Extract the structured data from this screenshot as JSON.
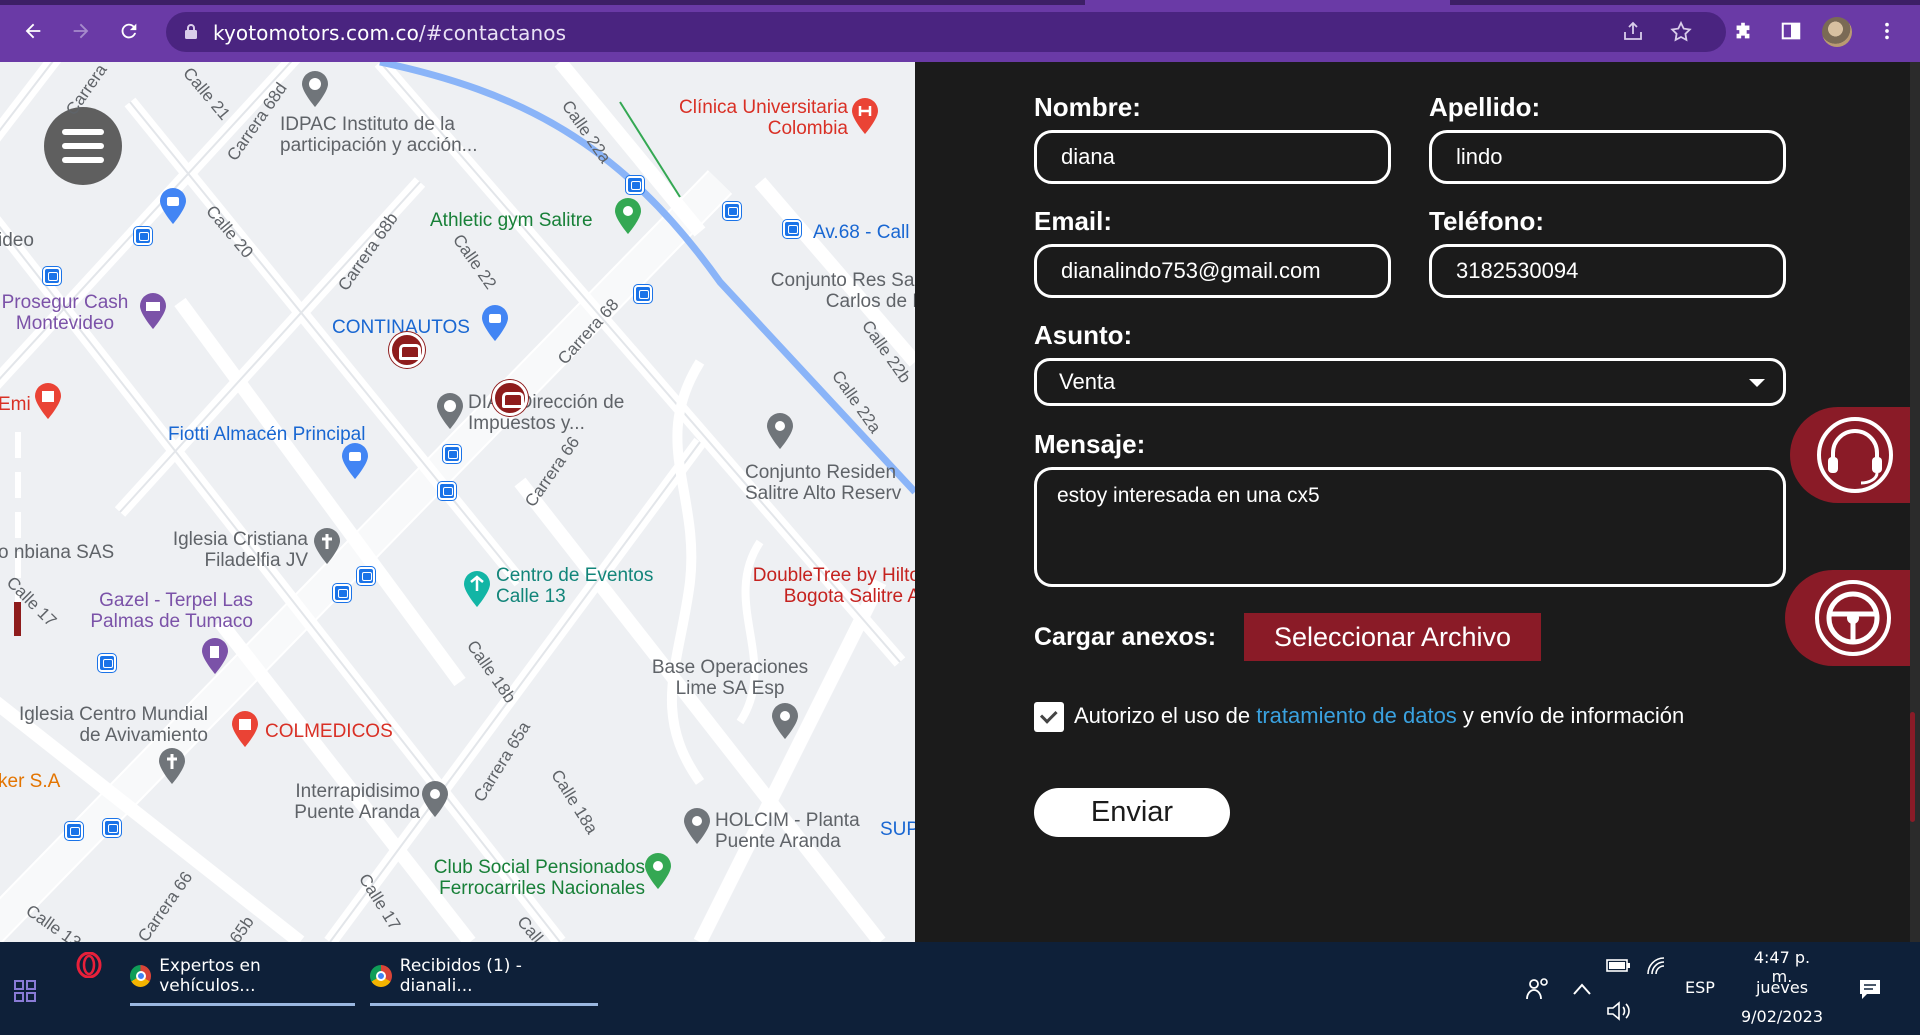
{
  "browser": {
    "url_host": "kyotomotors.com.co",
    "url_path": "/#contactanos",
    "icons": [
      "back-icon",
      "forward-icon",
      "reload-icon",
      "lock-icon",
      "share-icon",
      "star-icon",
      "extensions-icon",
      "sidepanel-icon",
      "avatar",
      "more-icon"
    ]
  },
  "map": {
    "places": {
      "idpac": "IDPAC Instituto de la participación y acción...",
      "clinica": "Clínica Universitaria Colombia",
      "athletic": "Athletic gym Salitre",
      "av68": "Av.68 - Call",
      "conjunto_res": "Conjunto Res San Carlos de B",
      "prosegur": "Prosegur Cash Montevideo",
      "continautos": "CONTINAUTOS",
      "dian": "DIAN Dirección de Impuestos y...",
      "emi": "Emi",
      "fiotti": "Fiotti Almacén Principal",
      "conjunto_salitre": "Conjunto Residen Salitre Alto Reserv",
      "iglesia_filadelfia": "Iglesia Cristiana Filadelfia JV",
      "nbiana": "o nbiana SAS",
      "centro_eventos": "Centro de Eventos Calle 13",
      "doubletree": "DoubleTree by Hilto Bogota Salitre A",
      "gazel": "Gazel - Terpel Las Palmas de Tumaco",
      "base_op": "Base Operaciones Lime SA Esp",
      "iglesia_centro": "Iglesia Centro Mundial de Avivamiento",
      "colmedicos": "COLMEDICOS",
      "ker": "ker S.A",
      "interrapidisimo": "Interrapidisimo Puente Aranda",
      "holcim": "HOLCIM - Planta Puente Aranda",
      "sup": "SUP",
      "club_social": "Club Social Pensionados Ferrocarriles Nacionales",
      "ideo": "ideo"
    },
    "streets": {
      "carrera_a": "Carrera",
      "calle21": "Calle 21",
      "carrera68d": "Carrera 68d",
      "calle22a": "Calle 22a",
      "calle20": "Calle 20",
      "carrera68b": "Carrera 68b",
      "calle22": "Calle 22",
      "carrera68": "Carrera 68",
      "calle22b": "Calle 22b",
      "calle22a_2": "Calle 22a",
      "carrera66": "Carrera 66",
      "calle17": "Calle 17",
      "calle18b": "Calle 18b",
      "carrera65a": "Carrera 65a",
      "calle18a": "Calle 18a",
      "carrera66_2": "Carrera 66",
      "calle17_2": "Calle 17",
      "calle13": "Calle 13",
      "k65b": "65b",
      "calle_c": "Call"
    }
  },
  "form": {
    "nombre_label": "Nombre:",
    "nombre_value": "diana",
    "apellido_label": "Apellido:",
    "apellido_value": "lindo",
    "email_label": "Email:",
    "email_value": "dianalindo753@gmail.com",
    "telefono_label": "Teléfono:",
    "telefono_value": "3182530094",
    "asunto_label": "Asunto:",
    "asunto_value": "Venta",
    "mensaje_label": "Mensaje:",
    "mensaje_value": "estoy interesada en una cx5",
    "anexos_label": "Cargar anexos:",
    "file_button": "Seleccionar Archivo",
    "consent_pre": "Autorizo el uso de ",
    "consent_link": "tratamiento de datos",
    "consent_post": " y envío de información",
    "consent_checked": true,
    "submit": "Enviar",
    "accent_color": "#8a1b27"
  },
  "taskbar": {
    "tasks": [
      "Expertos en vehículos...",
      "Recibidos (1) - dianali..."
    ],
    "lang": "ESP",
    "time": "4:47 p. m.",
    "day": "jueves",
    "date": "9/02/2023"
  }
}
